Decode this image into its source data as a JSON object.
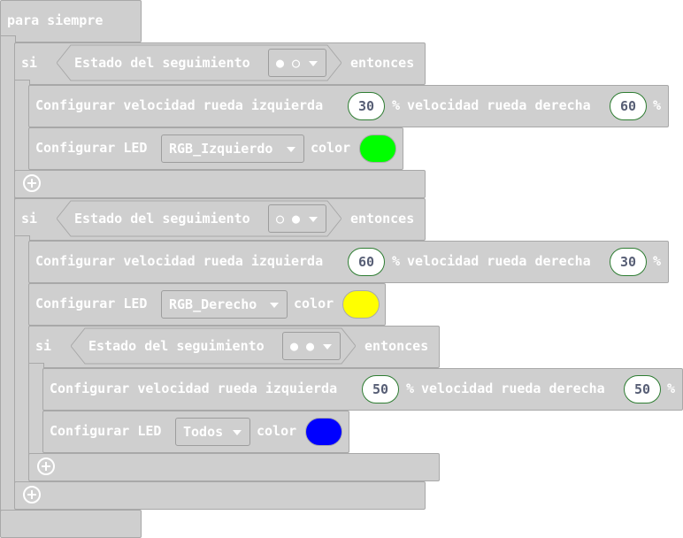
{
  "forever": {
    "label": "para siempre"
  },
  "if1": {
    "if_label": "si",
    "sensor_label": "Estado del seguimiento",
    "sensor_value": "● ○",
    "then_label": "entonces",
    "motor": {
      "label": "Configurar velocidad rueda izquierda",
      "left": "30",
      "pct1": "%",
      "right_label": "velocidad rueda derecha",
      "right": "60",
      "pct2": "%"
    },
    "led": {
      "label": "Configurar LED",
      "target": "RGB_Izquierdo",
      "color_label": "color",
      "color": "#00ff00"
    }
  },
  "if2": {
    "if_label": "si",
    "sensor_label": "Estado del seguimiento",
    "sensor_value": "○ ●",
    "then_label": "entonces",
    "motor": {
      "label": "Configurar velocidad rueda izquierda",
      "left": "60",
      "pct1": "%",
      "right_label": "velocidad rueda derecha",
      "right": "30",
      "pct2": "%"
    },
    "led": {
      "label": "Configurar LED",
      "target": "RGB_Derecho",
      "color_label": "color",
      "color": "#ffff00"
    },
    "nested_if": {
      "if_label": "si",
      "sensor_label": "Estado del seguimiento",
      "sensor_value": "● ●",
      "then_label": "entonces",
      "motor": {
        "label": "Configurar velocidad rueda izquierda",
        "left": "50",
        "pct1": "%",
        "right_label": "velocidad rueda derecha",
        "right": "50",
        "pct2": "%"
      },
      "led": {
        "label": "Configurar LED",
        "target": "Todos",
        "color_label": "color",
        "color": "#0000ff"
      }
    }
  }
}
